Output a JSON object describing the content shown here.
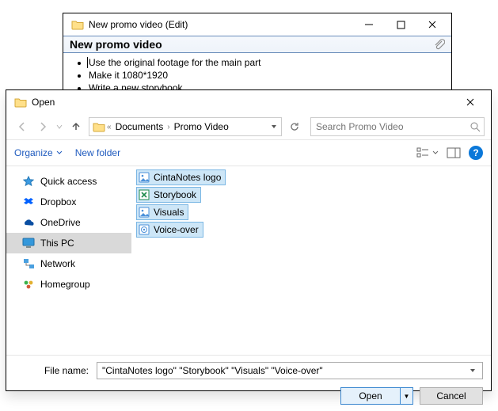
{
  "note": {
    "window_title": "New promo video (Edit)",
    "heading": "New promo video",
    "bullets": [
      "Use the original footage for the main part",
      "Make it 1080*1920",
      "Write a new storybook"
    ]
  },
  "dialog": {
    "title": "Open",
    "breadcrumbs": {
      "seg1": "Documents",
      "seg2": "Promo Video"
    },
    "search_placeholder": "Search Promo Video",
    "toolbar": {
      "organize": "Organize",
      "new_folder": "New folder"
    },
    "sidebar": {
      "items": [
        {
          "label": "Quick access"
        },
        {
          "label": "Dropbox"
        },
        {
          "label": "OneDrive"
        },
        {
          "label": "This PC"
        },
        {
          "label": "Network"
        },
        {
          "label": "Homegroup"
        }
      ]
    },
    "files": [
      {
        "label": "CintaNotes logo",
        "type": "image"
      },
      {
        "label": "Storybook",
        "type": "spreadsheet"
      },
      {
        "label": "Visuals",
        "type": "image"
      },
      {
        "label": "Voice-over",
        "type": "audio"
      }
    ],
    "file_name_label": "File name:",
    "file_name_value": "\"CintaNotes logo\" \"Storybook\" \"Visuals\" \"Voice-over\"",
    "buttons": {
      "open": "Open",
      "cancel": "Cancel"
    }
  }
}
